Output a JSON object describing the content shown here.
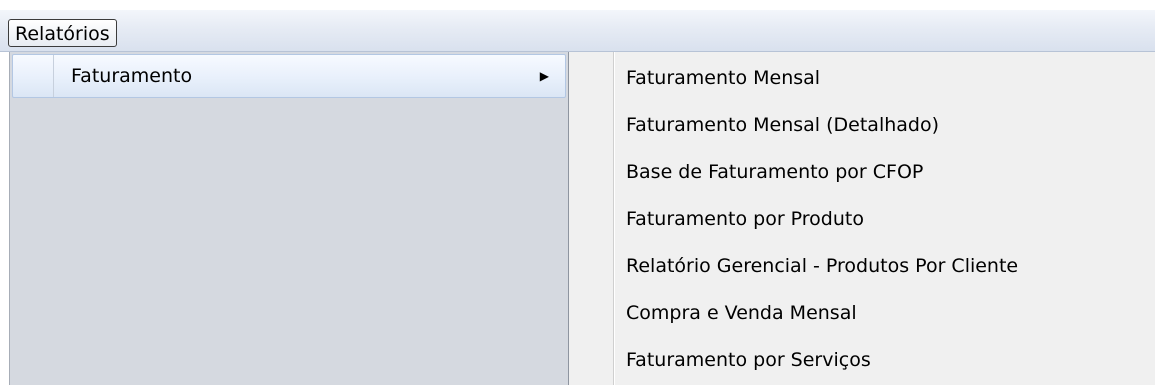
{
  "menubar": {
    "items": [
      {
        "label": "Relatórios"
      }
    ]
  },
  "dropdown": {
    "items": [
      {
        "label": "Faturamento",
        "arrow": "▶"
      }
    ]
  },
  "submenu": {
    "items": [
      {
        "label": "Faturamento Mensal"
      },
      {
        "label": "Faturamento Mensal (Detalhado)"
      },
      {
        "label": "Base de Faturamento por CFOP"
      },
      {
        "label": "Faturamento por Produto"
      },
      {
        "label": "Relatório Gerencial - Produtos Por Cliente"
      },
      {
        "label": "Compra e Venda Mensal"
      },
      {
        "label": "Faturamento por Serviços"
      }
    ]
  }
}
